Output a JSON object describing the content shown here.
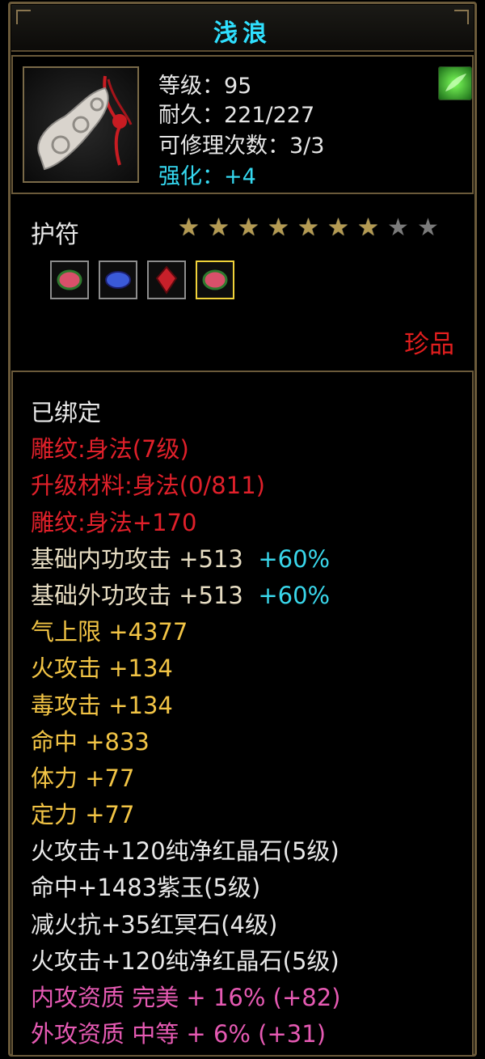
{
  "title": "浅浪",
  "item": {
    "stats": [
      {
        "text": "等级：95",
        "color": "white"
      },
      {
        "text": "耐久：221/227",
        "color": "white"
      },
      {
        "text": "可修理次数：3/3",
        "color": "white"
      },
      {
        "text": "强化：+4",
        "color": "cyan"
      }
    ],
    "icon_name": "jade-amulet-icon",
    "corner_icon_name": "green-charm-icon"
  },
  "type_label": "护符",
  "stars": {
    "filled": 7,
    "total": 9
  },
  "gems": [
    {
      "name": "pink-gem-icon",
      "color": "#d8506a",
      "selected": false
    },
    {
      "name": "blue-gem-icon",
      "color": "#3a5ad8",
      "selected": false
    },
    {
      "name": "red-crystal-icon",
      "color": "#c8202a",
      "selected": false
    },
    {
      "name": "pink-gem-icon",
      "color": "#d8506a",
      "selected": true
    }
  ],
  "rarity": "珍品",
  "attributes": [
    {
      "label": "已绑定",
      "value": "",
      "extra": "",
      "color": "white"
    },
    {
      "label": "雕纹:身法(7级)",
      "value": "",
      "extra": "",
      "color": "red"
    },
    {
      "label": "升级材料:身法(0/811)",
      "value": "",
      "extra": "",
      "color": "red"
    },
    {
      "label": "雕纹:身法+170",
      "value": "",
      "extra": "",
      "color": "red"
    },
    {
      "label": "基础内功攻击",
      "value": " +513",
      "extra": "+60%",
      "color": "tan"
    },
    {
      "label": "基础外功攻击",
      "value": " +513",
      "extra": "+60%",
      "color": "tan"
    },
    {
      "label": "气上限",
      "value": " +4377",
      "extra": "",
      "color": "yellow"
    },
    {
      "label": "火攻击",
      "value": " +134",
      "extra": "",
      "color": "yellow"
    },
    {
      "label": "毒攻击",
      "value": " +134",
      "extra": "",
      "color": "yellow"
    },
    {
      "label": "命中",
      "value": " +833",
      "extra": "",
      "color": "yellow"
    },
    {
      "label": "体力",
      "value": " +77",
      "extra": "",
      "color": "yellow"
    },
    {
      "label": "定力",
      "value": " +77",
      "extra": "",
      "color": "yellow"
    },
    {
      "label": "火攻击+120纯净红晶石(5级)",
      "value": "",
      "extra": "",
      "color": "white"
    },
    {
      "label": "命中+1483紫玉(5级)",
      "value": "",
      "extra": "",
      "color": "white"
    },
    {
      "label": "减火抗+35红冥石(4级)",
      "value": "",
      "extra": "",
      "color": "white"
    },
    {
      "label": "火攻击+120纯净红晶石(5级)",
      "value": "",
      "extra": "",
      "color": "white"
    },
    {
      "label": "内攻资质 完美 + 16% (+82)",
      "value": "",
      "extra": "",
      "color": "pink"
    },
    {
      "label": "外攻资质 中等 + 6% (+31)",
      "value": "",
      "extra": "",
      "color": "pink"
    }
  ]
}
